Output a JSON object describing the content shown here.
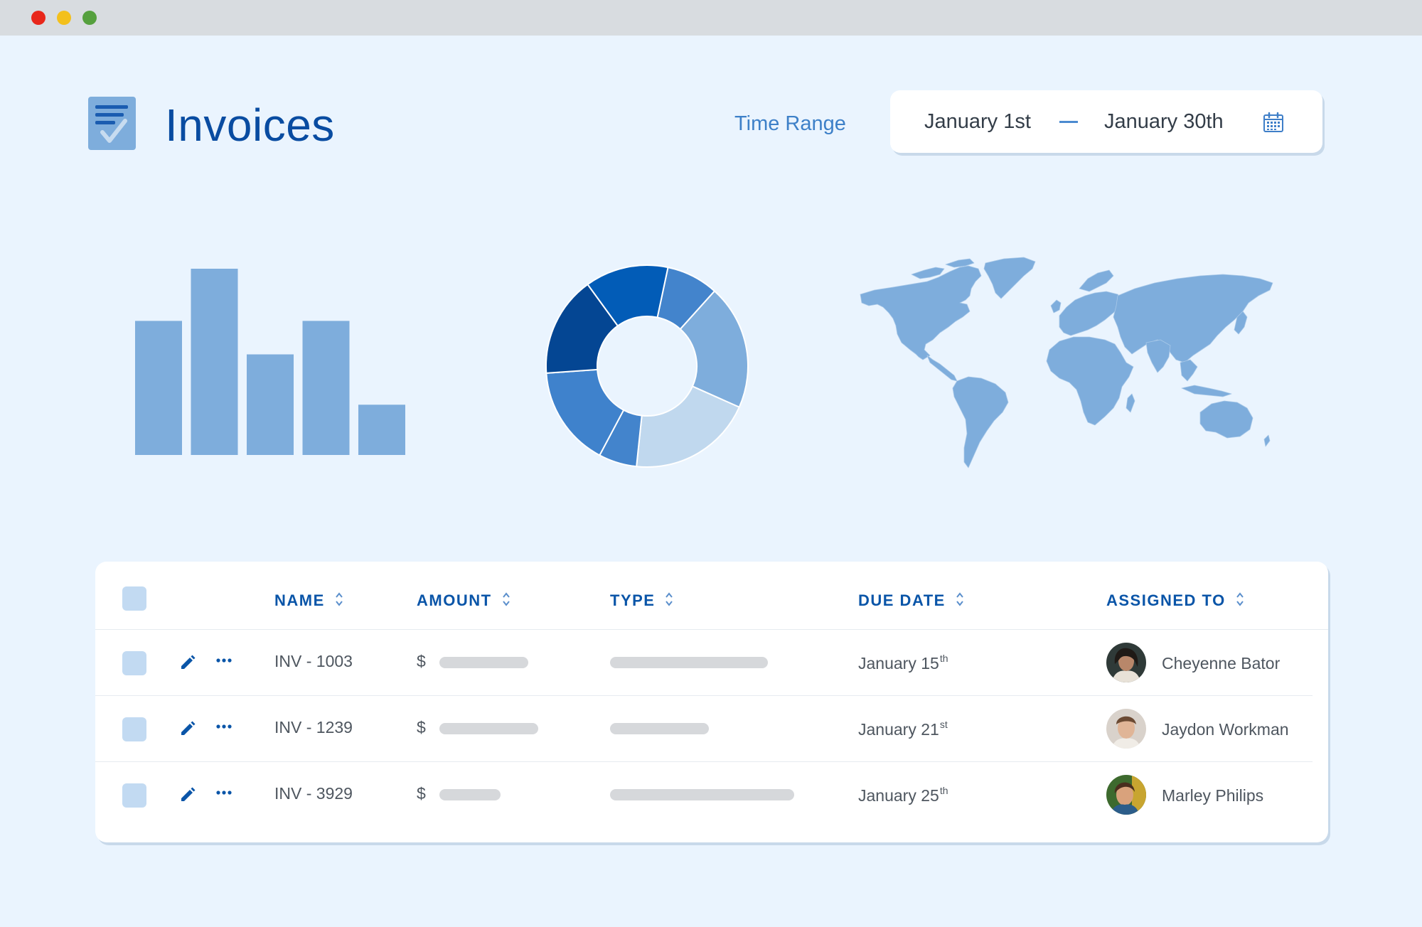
{
  "window": {
    "controls": [
      "close",
      "minimize",
      "maximize"
    ]
  },
  "header": {
    "title": "Invoices",
    "logo_icon": "checklist-document-icon",
    "time_range_label": "Time Range",
    "date_start": "January 1st",
    "date_separator": "—",
    "date_end": "January 30th",
    "calendar_icon": "calendar-icon"
  },
  "bar_chart": {
    "values": [
      0.72,
      1.0,
      0.54,
      0.72,
      0.27
    ],
    "color": "#7eaddc"
  },
  "donut_chart": {
    "segments": [
      {
        "value": 30,
        "color": "#4384cc"
      },
      {
        "value": 72,
        "color": "#7eaddc"
      },
      {
        "value": 72,
        "color": "#c0d8ee"
      },
      {
        "value": 22,
        "color": "#4384cc"
      },
      {
        "value": 58,
        "color": "#3f82cc"
      },
      {
        "value": 58,
        "color": "#044693"
      },
      {
        "value": 48,
        "color": "#025cb7"
      }
    ]
  },
  "map": {
    "color": "#7eaddc"
  },
  "table": {
    "columns": [
      {
        "key": "name",
        "label": "NAME"
      },
      {
        "key": "amount",
        "label": "AMOUNT"
      },
      {
        "key": "type",
        "label": "TYPE"
      },
      {
        "key": "due_date",
        "label": "DUE DATE"
      },
      {
        "key": "assigned_to",
        "label": "ASSIGNED TO"
      }
    ],
    "currency_symbol": "$",
    "rows": [
      {
        "name": "INV - 1003",
        "due_month": "January 15",
        "due_suffix": "th",
        "assigned_to": "Cheyenne Bator",
        "amount_fill": 0.45,
        "type_fill": 0.8
      },
      {
        "name": "INV - 1239",
        "due_month": "January 21",
        "due_suffix": "st",
        "assigned_to": "Jaydon Workman",
        "amount_fill": 0.5,
        "type_fill": 0.5
      },
      {
        "name": "INV - 3929",
        "due_month": "January 25",
        "due_suffix": "th",
        "assigned_to": "Marley Philips",
        "amount_fill": 0.31,
        "type_fill": 0.93
      }
    ]
  },
  "colors": {
    "accent": "#094ca1",
    "background": "#eaf4fe",
    "chart": "#7eaddc"
  }
}
